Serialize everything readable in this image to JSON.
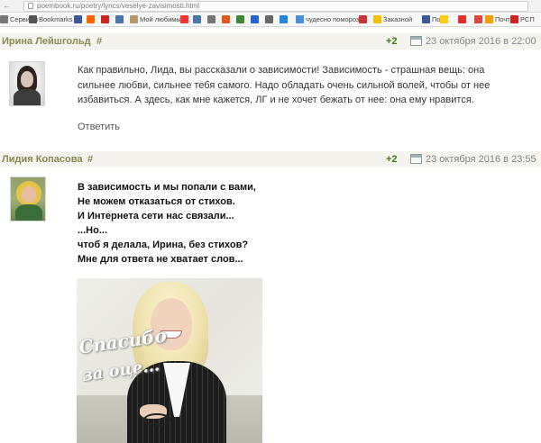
{
  "browser": {
    "url": "poembook.ru/poetry/lyrics/veselye-zavisimosti.html",
    "bookmarks": [
      {
        "label": "Сервисы",
        "color": "#777777"
      },
      {
        "label": "Bookmarks",
        "color": "#555555"
      },
      {
        "label": "",
        "color": "#3b5998"
      },
      {
        "label": "",
        "color": "#ff6600"
      },
      {
        "label": "",
        "color": "#cc2222"
      },
      {
        "label": "",
        "color": "#4a76a8"
      },
      {
        "label": "Мой любимый...",
        "color": "#b49a6a"
      },
      {
        "label": "",
        "color": "#ff3333"
      },
      {
        "label": "",
        "color": "#4a76a8"
      },
      {
        "label": "",
        "color": "#777777"
      },
      {
        "label": "",
        "color": "#e05a1e"
      },
      {
        "label": "",
        "color": "#3a8a3a"
      },
      {
        "label": "",
        "color": "#2266cc"
      },
      {
        "label": "",
        "color": "#666666"
      },
      {
        "label": "",
        "color": "#2288dd"
      },
      {
        "label": "чудесно поморозки",
        "color": "#4a90d9"
      },
      {
        "label": "",
        "color": "#cc3333"
      },
      {
        "label": "Заказной",
        "color": "#f2c200"
      },
      {
        "label": "Пого",
        "color": "#3b5998"
      },
      {
        "label": "",
        "color": "#ffcc00"
      },
      {
        "label": "",
        "color": "#e03030"
      },
      {
        "label": "",
        "color": "#d44"
      },
      {
        "label": "Почта",
        "color": "#f2a000"
      },
      {
        "label": "РСП",
        "color": "#cc2222"
      }
    ]
  },
  "comments": [
    {
      "author": "Ирина Лейшгольд",
      "hash": "#",
      "score": "+2",
      "date": "23 октября 2016 в 22:00",
      "text": "Как правильно, Лида, вы рассказали о зависимости! Зависимость - страшная вещь: она сильнее любви, сильнее тебя самого. Надо обладать очень сильной волей, чтобы от нее избавиться. А здесь, как мне кажется, ЛГ и не хочет бежать от нее: она ему нравится.",
      "reply": "Ответить"
    },
    {
      "author": "Лидия Копасова",
      "hash": "#",
      "score": "+2",
      "date": "23 октября 2016 в 23:55",
      "poem": [
        "В зависимость и мы попали с вами,",
        "Не можем отказаться от стихов.",
        "И Интернета сети нас связали...",
        "...Но...",
        "чтоб я делала, Ирина, без стихов?",
        "Мне для ответа не хватает слов..."
      ],
      "image_caption": [
        "Спасибо",
        "за оце..."
      ]
    }
  ]
}
